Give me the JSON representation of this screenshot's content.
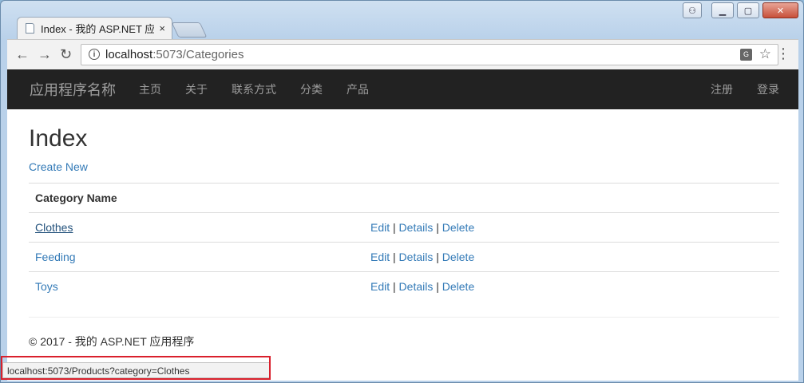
{
  "tab": {
    "title": "Index - 我的 ASP.NET 应",
    "close": "×"
  },
  "toolbar": {
    "back": "←",
    "forward": "→",
    "reload": "↻",
    "url_host": "localhost",
    "url_path": ":5073/Categories",
    "translate": "G",
    "star": "☆",
    "menu": "⋮"
  },
  "navbar": {
    "brand": "应用程序名称",
    "items": [
      {
        "label": "主页"
      },
      {
        "label": "关于"
      },
      {
        "label": "联系方式"
      },
      {
        "label": "分类"
      },
      {
        "label": "产品"
      }
    ],
    "right_items": [
      {
        "label": "注册"
      },
      {
        "label": "登录"
      }
    ]
  },
  "page": {
    "heading": "Index",
    "create_link": "Create New",
    "table": {
      "header": "Category Name",
      "rows": [
        {
          "name": "Clothes",
          "edit": "Edit",
          "details": "Details",
          "delete": "Delete"
        },
        {
          "name": "Feeding",
          "edit": "Edit",
          "details": "Details",
          "delete": "Delete"
        },
        {
          "name": "Toys",
          "edit": "Edit",
          "details": "Details",
          "delete": "Delete"
        }
      ],
      "separator": "|"
    },
    "footer": "© 2017 - 我的 ASP.NET 应用程序"
  },
  "status_bar": {
    "text": "localhost:5073/Products?category=Clothes"
  },
  "colors": {
    "link": "#337ab7",
    "navbar_bg": "#222222",
    "highlight": "#d9202c"
  }
}
